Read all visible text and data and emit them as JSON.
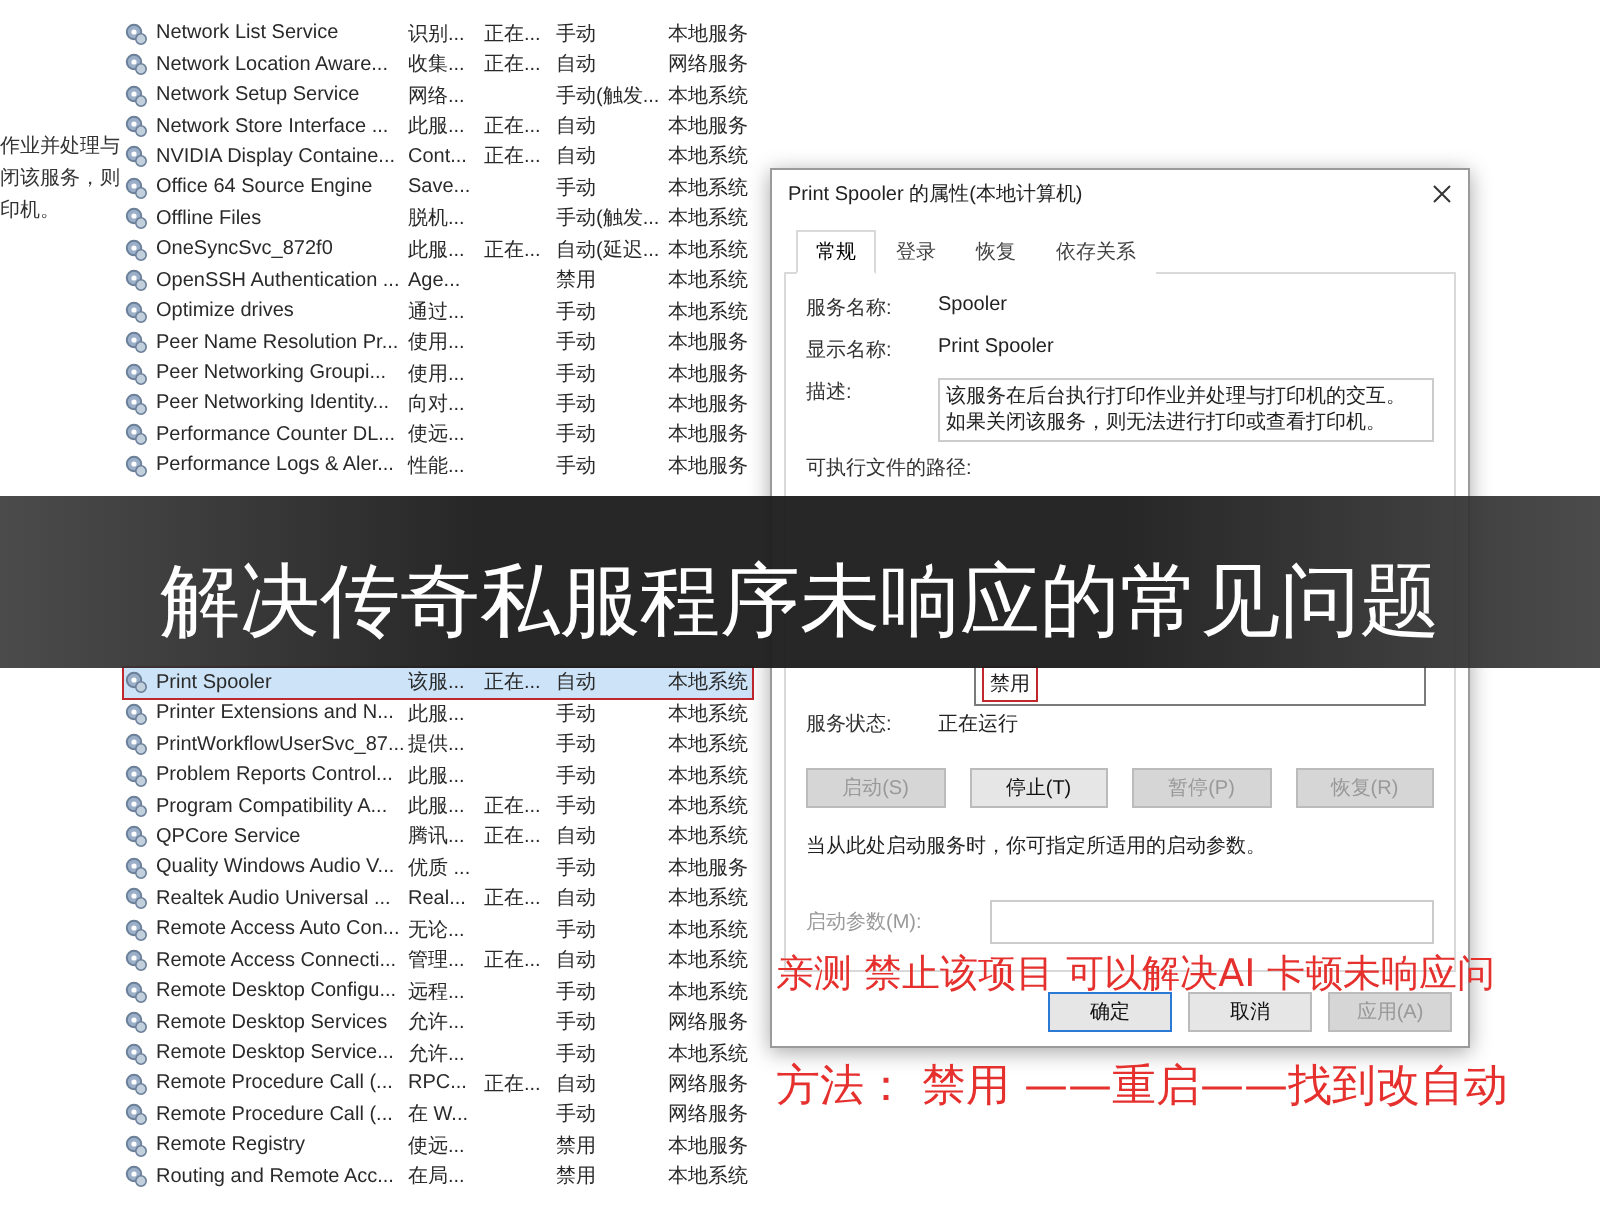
{
  "background_description": {
    "lines": [
      "作业并处理与",
      "闭该服务，则",
      "印机。"
    ]
  },
  "services_list": {
    "rows_above": [
      {
        "name": "Network List Service",
        "description": "识别...",
        "status": "正在...",
        "startup_type": "手动",
        "log_on_as": "本地服务",
        "selected": false
      },
      {
        "name": "Network Location Aware...",
        "description": "收集...",
        "status": "正在...",
        "startup_type": "自动",
        "log_on_as": "网络服务",
        "selected": false
      },
      {
        "name": "Network Setup Service",
        "description": "网络...",
        "startup_type": "手动(触发...",
        "log_on_as": "本地系统",
        "selected": false
      },
      {
        "name": "Network Store Interface ...",
        "description": "此服...",
        "status": "正在...",
        "startup_type": "自动",
        "log_on_as": "本地服务",
        "selected": false
      },
      {
        "name": "NVIDIA Display Containe...",
        "description": "Cont...",
        "status": "正在...",
        "startup_type": "自动",
        "log_on_as": "本地系统",
        "selected": false
      },
      {
        "name": "Office 64 Source Engine",
        "description": "Save...",
        "startup_type": "手动",
        "log_on_as": "本地系统",
        "selected": false
      },
      {
        "name": "Offline Files",
        "description": "脱机...",
        "startup_type": "手动(触发...",
        "log_on_as": "本地系统",
        "selected": false
      },
      {
        "name": "OneSyncSvc_872f0",
        "description": "此服...",
        "status": "正在...",
        "startup_type": "自动(延迟...",
        "log_on_as": "本地系统",
        "selected": false
      },
      {
        "name": "OpenSSH Authentication ...",
        "description": "Age...",
        "startup_type": "禁用",
        "log_on_as": "本地系统",
        "selected": false
      },
      {
        "name": "Optimize drives",
        "description": "通过...",
        "startup_type": "手动",
        "log_on_as": "本地系统",
        "selected": false
      },
      {
        "name": "Peer Name Resolution Pr...",
        "description": "使用...",
        "startup_type": "手动",
        "log_on_as": "本地服务",
        "selected": false
      },
      {
        "name": "Peer Networking Groupi...",
        "description": "使用...",
        "startup_type": "手动",
        "log_on_as": "本地服务",
        "selected": false
      },
      {
        "name": "Peer Networking Identity...",
        "description": "向对...",
        "startup_type": "手动",
        "log_on_as": "本地服务",
        "selected": false
      },
      {
        "name": "Performance Counter DL...",
        "description": "使远...",
        "startup_type": "手动",
        "log_on_as": "本地服务",
        "selected": false
      },
      {
        "name": "Performance Logs & Aler...",
        "description": "性能...",
        "startup_type": "手动",
        "log_on_as": "本地服务",
        "selected": false
      }
    ],
    "rows_below": [
      {
        "name": "Print Spooler",
        "description": "该服...",
        "status": "正在...",
        "startup_type": "自动",
        "log_on_as": "本地系统",
        "selected": true
      },
      {
        "name": "Printer Extensions and N...",
        "description": "此服...",
        "startup_type": "手动",
        "log_on_as": "本地系统",
        "selected": false
      },
      {
        "name": "PrintWorkflowUserSvc_87...",
        "description": "提供...",
        "startup_type": "手动",
        "log_on_as": "本地系统",
        "selected": false
      },
      {
        "name": "Problem Reports Control...",
        "description": "此服...",
        "startup_type": "手动",
        "log_on_as": "本地系统",
        "selected": false
      },
      {
        "name": "Program Compatibility A...",
        "description": "此服...",
        "status": "正在...",
        "startup_type": "手动",
        "log_on_as": "本地系统",
        "selected": false
      },
      {
        "name": "QPCore Service",
        "description": "腾讯...",
        "status": "正在...",
        "startup_type": "自动",
        "log_on_as": "本地系统",
        "selected": false
      },
      {
        "name": "Quality Windows Audio V...",
        "description": "优质 ...",
        "startup_type": "手动",
        "log_on_as": "本地服务",
        "selected": false
      },
      {
        "name": "Realtek Audio Universal ...",
        "description": "Real...",
        "status": "正在...",
        "startup_type": "自动",
        "log_on_as": "本地系统",
        "selected": false
      },
      {
        "name": "Remote Access Auto Con...",
        "description": "无论...",
        "startup_type": "手动",
        "log_on_as": "本地系统",
        "selected": false
      },
      {
        "name": "Remote Access Connecti...",
        "description": "管理...",
        "status": "正在...",
        "startup_type": "自动",
        "log_on_as": "本地系统",
        "selected": false
      },
      {
        "name": "Remote Desktop Configu...",
        "description": "远程...",
        "startup_type": "手动",
        "log_on_as": "本地系统",
        "selected": false
      },
      {
        "name": "Remote Desktop Services",
        "description": "允许...",
        "startup_type": "手动",
        "log_on_as": "网络服务",
        "selected": false
      },
      {
        "name": "Remote Desktop Service...",
        "description": "允许...",
        "startup_type": "手动",
        "log_on_as": "本地系统",
        "selected": false
      },
      {
        "name": "Remote Procedure Call (...",
        "description": "RPC...",
        "status": "正在...",
        "startup_type": "自动",
        "log_on_as": "网络服务",
        "selected": false
      },
      {
        "name": "Remote Procedure Call (...",
        "description": "在 W...",
        "startup_type": "手动",
        "log_on_as": "网络服务",
        "selected": false
      },
      {
        "name": "Remote Registry",
        "description": "使远...",
        "startup_type": "禁用",
        "log_on_as": "本地服务",
        "selected": false
      },
      {
        "name": "Routing and Remote Acc...",
        "description": "在局...",
        "startup_type": "禁用",
        "log_on_as": "本地系统",
        "selected": false
      }
    ]
  },
  "properties_dialog": {
    "title": "Print Spooler 的属性(本地计算机)",
    "tabs": [
      {
        "label": "常规",
        "selected": true
      },
      {
        "label": "登录",
        "selected": false
      },
      {
        "label": "恢复",
        "selected": false
      },
      {
        "label": "依存关系",
        "selected": false
      }
    ],
    "fields": [
      {
        "label": "服务名称:",
        "value": "Spooler"
      },
      {
        "label": "显示名称:",
        "value": "Print Spooler"
      }
    ],
    "description": {
      "label": "描述:",
      "value": "该服务在后台执行打印作业并处理与打印机的交互。如果关闭该服务，则无法进行打印或查看打印机。"
    },
    "path": {
      "label": "可执行文件的路径:"
    },
    "startup_options": [
      {
        "label": "禁用",
        "annotated": true
      }
    ],
    "service_status": {
      "label": "服务状态:",
      "value": "正在运行"
    },
    "control_buttons": [
      {
        "label": "启动(S)",
        "disabled": true
      },
      {
        "label": "停止(T)",
        "disabled": false
      },
      {
        "label": "暂停(P)",
        "disabled": true
      },
      {
        "label": "恢复(R)",
        "disabled": true
      }
    ],
    "hint": "当从此处启动服务时，你可指定所适用的启动参数。",
    "start_params": {
      "label": "启动参数(M):"
    },
    "footer_buttons": [
      {
        "label": "确定",
        "default": true,
        "disabled": false
      },
      {
        "label": "取消",
        "default": false,
        "disabled": false
      },
      {
        "label": "应用(A)",
        "default": false,
        "disabled": true
      }
    ]
  },
  "banner": {
    "title": "解决传奇私服程序未响应的常见问题"
  },
  "annotations": [
    {
      "text": "亲测 禁止该项目  可以解决AI 卡顿未响应问"
    },
    {
      "text": "方法：  禁用 ——重启——找到改自动"
    }
  ]
}
